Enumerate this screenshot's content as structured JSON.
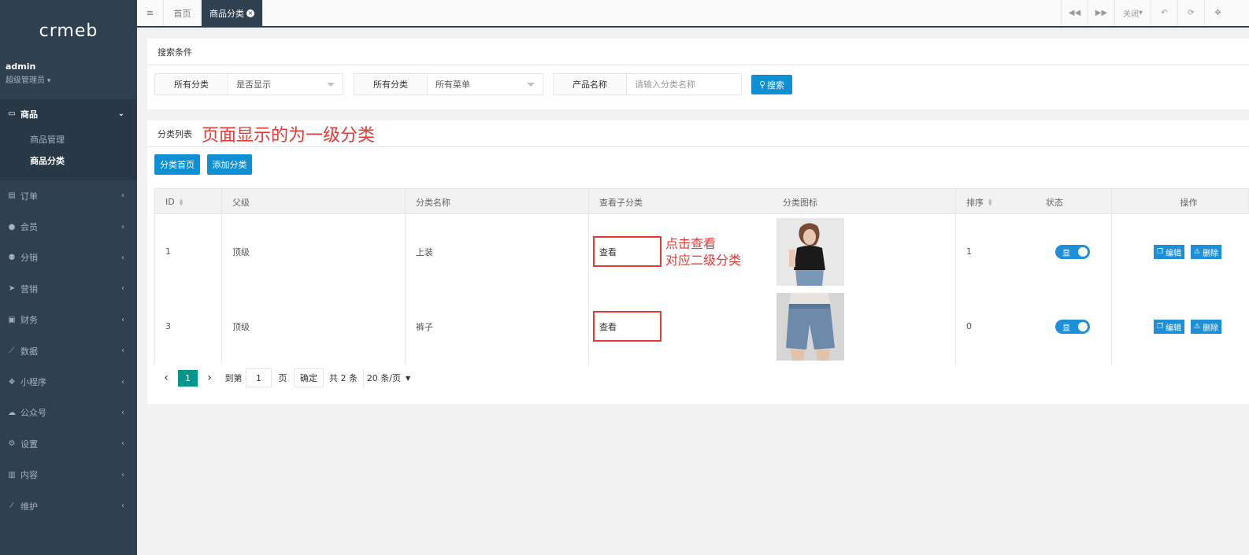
{
  "app": {
    "logo": "crmeb"
  },
  "user": {
    "name": "admin",
    "role": "超级管理员"
  },
  "sidebar": {
    "active_group": {
      "label": "商品",
      "icon": "laptop-icon"
    },
    "sub_items": [
      {
        "label": "商品管理",
        "active": false
      },
      {
        "label": "商品分类",
        "active": true
      }
    ],
    "items": [
      {
        "label": "订单",
        "icon": "clipboard-icon"
      },
      {
        "label": "会员",
        "icon": "user-icon"
      },
      {
        "label": "分销",
        "icon": "users-icon"
      },
      {
        "label": "营销",
        "icon": "paper-plane-icon"
      },
      {
        "label": "财务",
        "icon": "money-icon"
      },
      {
        "label": "数据",
        "icon": "line-chart-icon"
      },
      {
        "label": "小程序",
        "icon": "cubes-icon"
      },
      {
        "label": "公众号",
        "icon": "wechat-icon"
      },
      {
        "label": "设置",
        "icon": "gear-icon"
      },
      {
        "label": "内容",
        "icon": "book-icon"
      },
      {
        "label": "维护",
        "icon": "magic-wand-icon"
      }
    ]
  },
  "tabs": [
    {
      "label": "首页"
    },
    {
      "label": "商品分类",
      "active": true
    }
  ],
  "topbar_right": {
    "close_label": "关闭"
  },
  "search": {
    "title": "搜索条件",
    "filters": [
      {
        "label": "所有分类",
        "value": "是否显示"
      },
      {
        "label": "所有分类",
        "value": "所有菜单"
      },
      {
        "label": "产品名称",
        "placeholder": "请输入分类名称"
      }
    ],
    "search_button": "搜索"
  },
  "list": {
    "title": "分类列表",
    "annotation": "页面显示的为一级分类",
    "btn_home": "分类首页",
    "btn_add": "添加分类",
    "columns": [
      "ID",
      "父级",
      "分类名称",
      "查看子分类",
      "分类图标",
      "排序",
      "状态",
      "操作"
    ],
    "rows": [
      {
        "id": "1",
        "parent": "顶级",
        "name": "上装",
        "view": "查看",
        "sort": "1",
        "status": "显"
      },
      {
        "id": "3",
        "parent": "顶级",
        "name": "裤子",
        "view": "查看",
        "sort": "0",
        "status": "显"
      }
    ],
    "view_annotation_line1": "点击查看",
    "view_annotation_line2": "对应二级分类",
    "edit_label": "编辑",
    "delete_label": "删除"
  },
  "pagination": {
    "current": "1",
    "goto_label": "到第",
    "page_input": "1",
    "page_unit": "页",
    "confirm": "确定",
    "total": "共 2 条",
    "page_size": "20 条/页"
  },
  "colors": {
    "sidebar_bg": "#2f4050",
    "primary": "#1e90d8",
    "annotation": "#e53935",
    "page_active": "#009688"
  }
}
